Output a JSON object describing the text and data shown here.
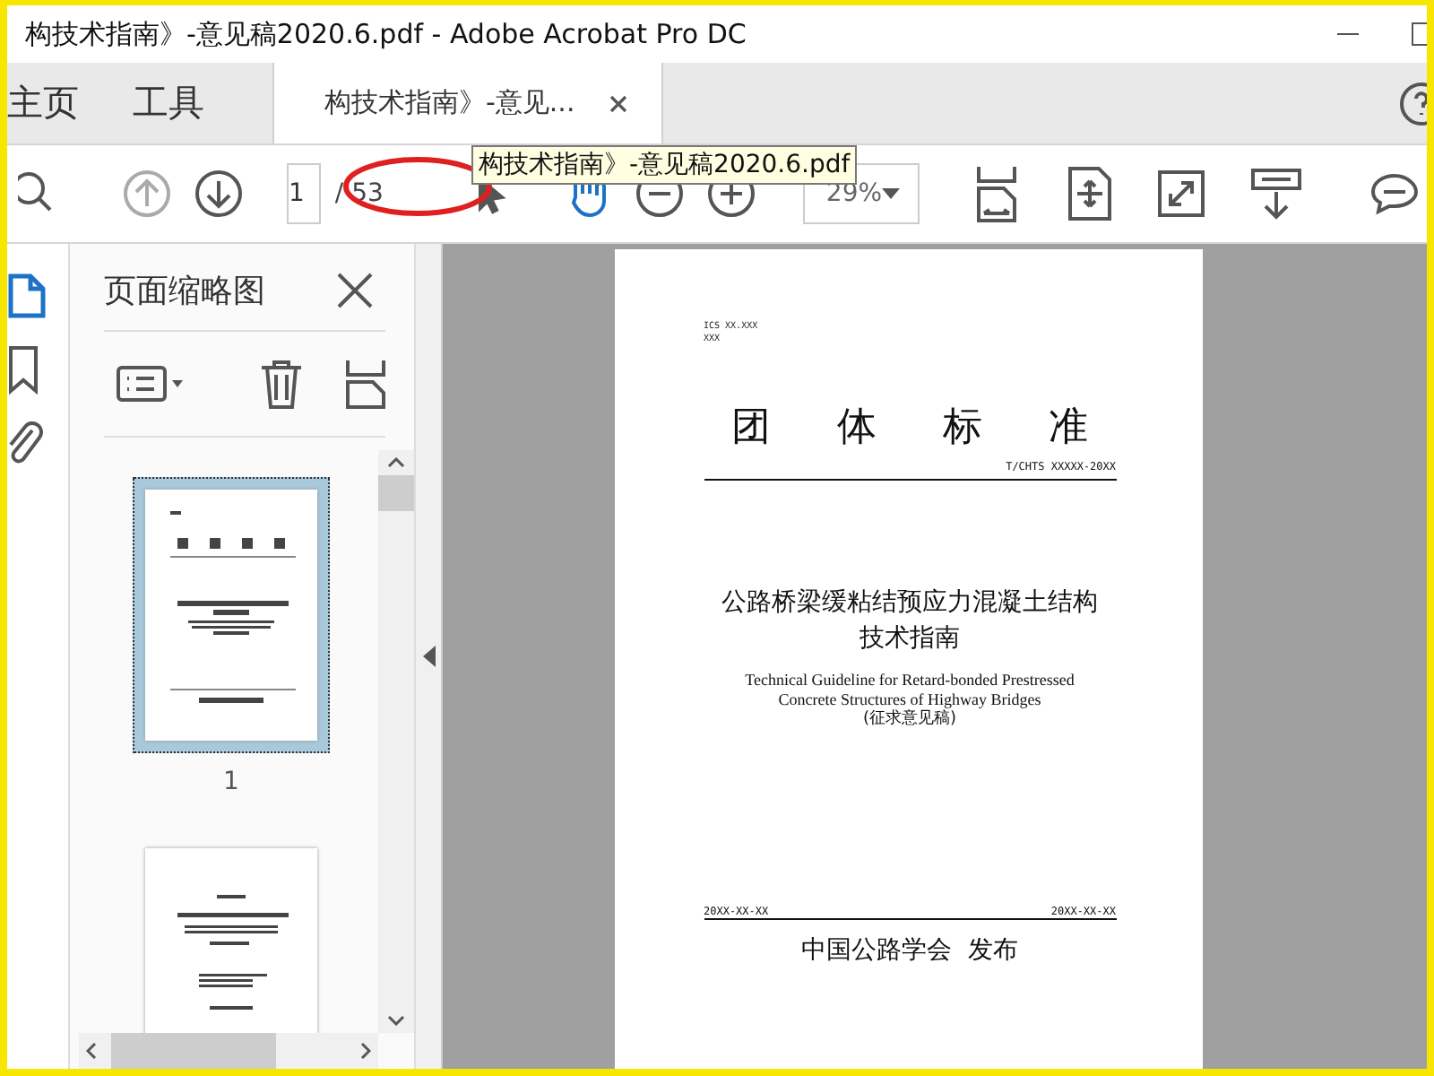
{
  "window": {
    "title": "构技术指南》-意见稿2020.6.pdf - Adobe Acrobat Pro DC"
  },
  "tabs": [
    {
      "label": "主页",
      "selected": false,
      "kind": "nav"
    },
    {
      "label": "工具",
      "selected": false,
      "kind": "nav"
    },
    {
      "label": "构技术指南》-意见...",
      "selected": true,
      "kind": "document"
    }
  ],
  "toolbar": {
    "page_number": "1",
    "page_total": "/ 53",
    "zoom": "29%",
    "tooltip": "构技术指南》-意见稿2020.6.pdf"
  },
  "panel": {
    "title": "页面缩略图",
    "thumbnails": [
      {
        "label": "1",
        "selected": true
      },
      {
        "selected": false
      }
    ]
  },
  "document": {
    "code_lines": [
      "ICS XX.XXX",
      "XXX"
    ],
    "standard_type": "团 体 标 准",
    "standard_number": "T/CHTS XXXXX-20XX",
    "title_lines": [
      "公路桥梁缓粘结预应力混凝土结构",
      "技术指南"
    ],
    "english_lines": [
      "Technical Guideline for Retard-bonded Prestressed",
      "Concrete Structures of Highway Bridges"
    ],
    "draft_note": "(征求意见稿)",
    "issue_date": "20XX-XX-XX",
    "effective_date": "20XX-XX-XX",
    "publisher": "中国公路学会  发布"
  }
}
